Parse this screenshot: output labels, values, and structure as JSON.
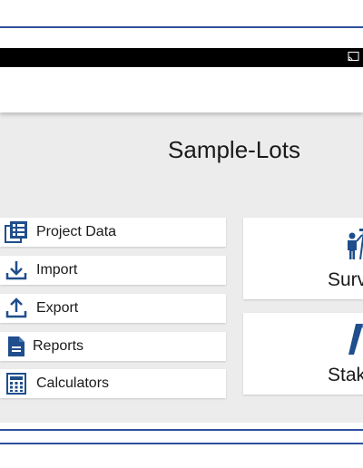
{
  "header": {
    "project_title": "Sample-Lots"
  },
  "menu": {
    "items": [
      {
        "label": "Project Data",
        "icon": "project-data-icon"
      },
      {
        "label": "Import",
        "icon": "import-icon"
      },
      {
        "label": "Export",
        "icon": "export-icon"
      },
      {
        "label": "Reports",
        "icon": "reports-icon"
      },
      {
        "label": "Calculators",
        "icon": "calculator-icon"
      }
    ]
  },
  "tiles": [
    {
      "label": "Surv",
      "icon": "surveyor-icon"
    },
    {
      "label": "Stak",
      "icon": "stakeout-icon"
    }
  ],
  "colors": {
    "accent": "#1f4e8c",
    "frame": "#2f4f9e",
    "background": "#ececec"
  }
}
